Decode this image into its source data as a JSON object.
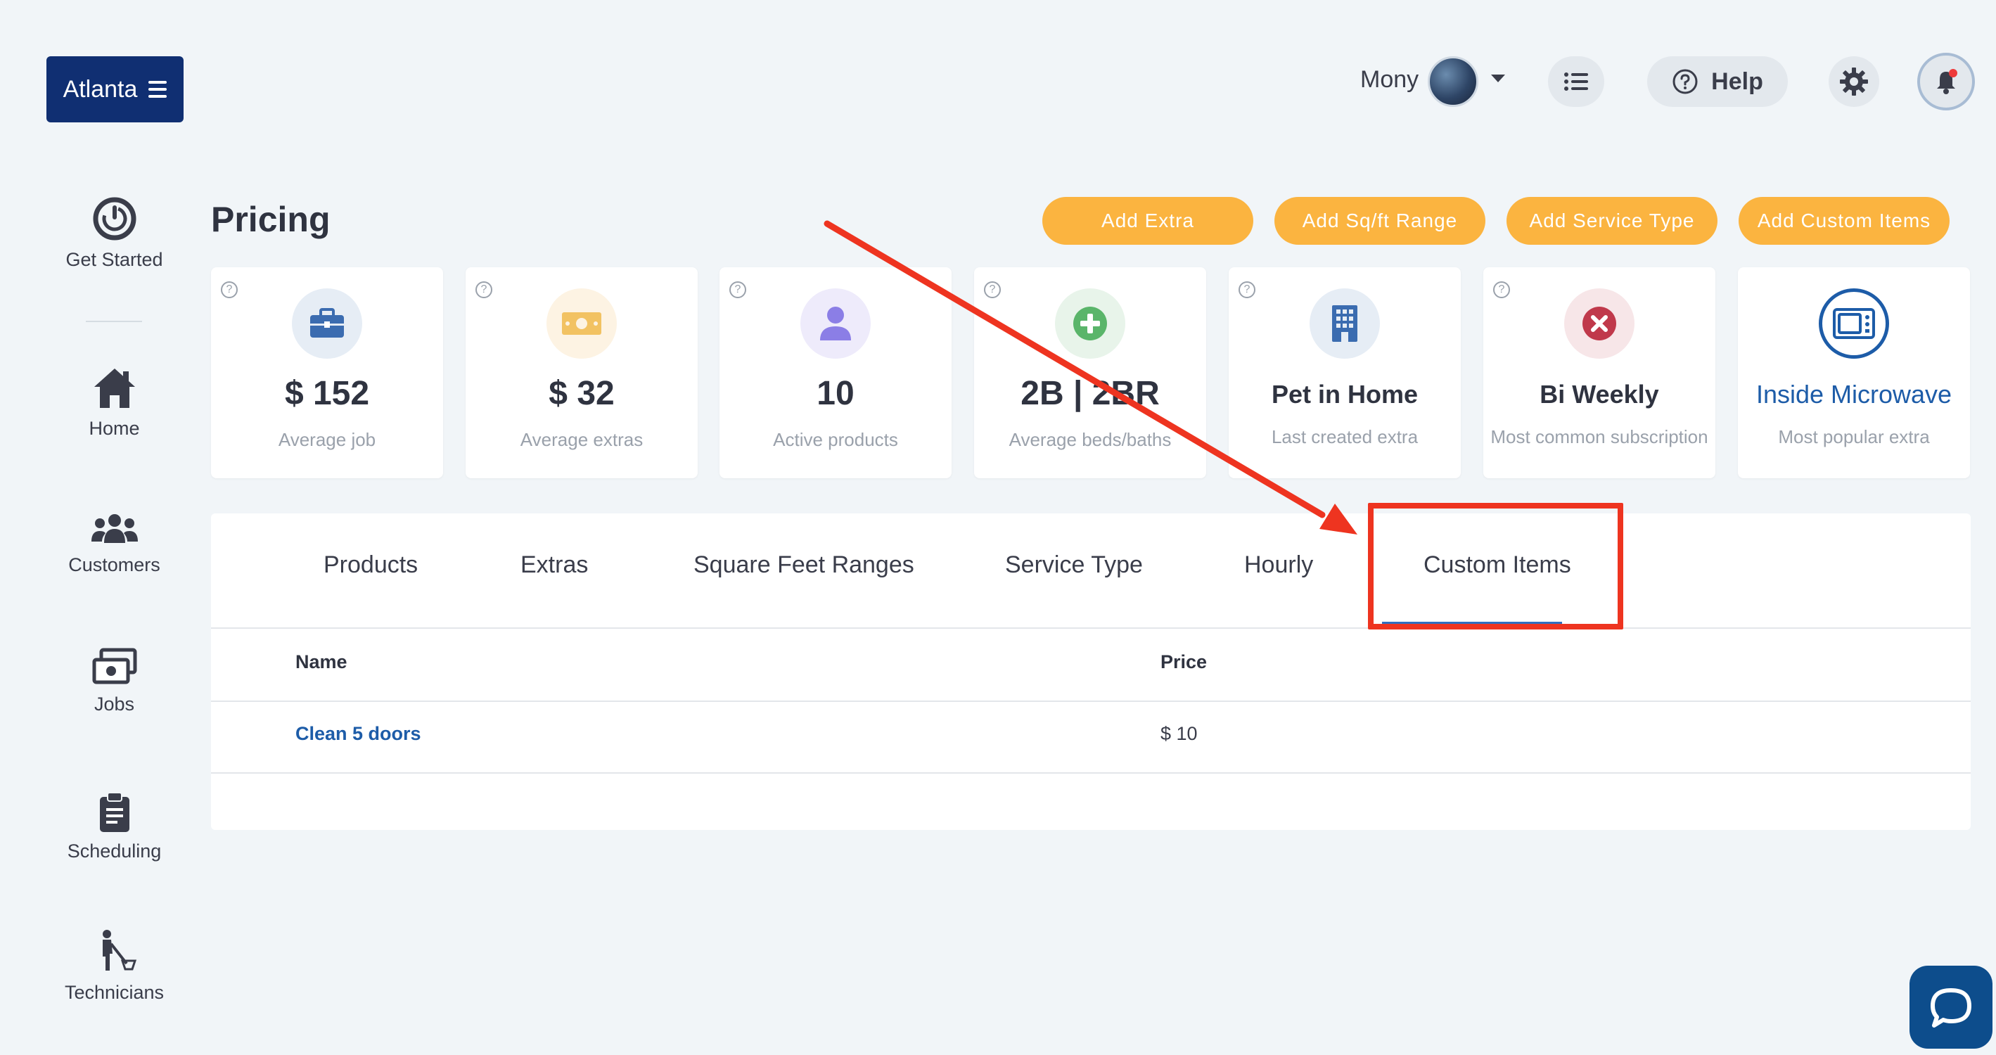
{
  "header": {
    "location_label": "Atlanta",
    "user_name": "Mony",
    "help_label": "Help"
  },
  "sidebar": {
    "items": [
      {
        "label": "Get Started"
      },
      {
        "label": "Home"
      },
      {
        "label": "Customers"
      },
      {
        "label": "Jobs"
      },
      {
        "label": "Scheduling"
      },
      {
        "label": "Technicians"
      }
    ]
  },
  "page": {
    "title": "Pricing",
    "actions": [
      "Add Extra",
      "Add Sq/ft Range",
      "Add Service Type",
      "Add Custom Items"
    ]
  },
  "stats": [
    {
      "value": "$ 152",
      "label": "Average job",
      "icon": "briefcase-icon",
      "color": "#3b6cb0"
    },
    {
      "value": "$ 32",
      "label": "Average extras",
      "icon": "cash-icon",
      "color": "#f2c262"
    },
    {
      "value": "10",
      "label": "Active products",
      "icon": "user-icon",
      "color": "#8b7ee6"
    },
    {
      "value": "2B | 2BR",
      "label": "Average beds/baths",
      "icon": "plus-circle-icon",
      "color": "#5ab56a"
    },
    {
      "value": "Pet in Home",
      "label": "Last created extra",
      "icon": "building-icon",
      "color": "#3b6cb0"
    },
    {
      "value": "Bi Weekly",
      "label": "Most common subscription",
      "icon": "x-circle-icon",
      "color": "#c0394b"
    },
    {
      "value": "Inside Microwave",
      "label": "Most popular extra",
      "icon": "microwave-icon",
      "color": "#1d5ca8"
    }
  ],
  "tabs": {
    "items": [
      "Products",
      "Extras",
      "Square Feet Ranges",
      "Service Type",
      "Hourly",
      "Custom Items"
    ],
    "active": "Custom Items"
  },
  "table": {
    "columns": [
      "Name",
      "Price"
    ],
    "rows": [
      {
        "name": "Clean 5 doors",
        "price": "$ 10"
      }
    ]
  },
  "colors": {
    "brand": "#102f72",
    "accent_orange": "#fbb440",
    "link_blue": "#1d5ca8",
    "annotation_red": "#ee3420"
  }
}
